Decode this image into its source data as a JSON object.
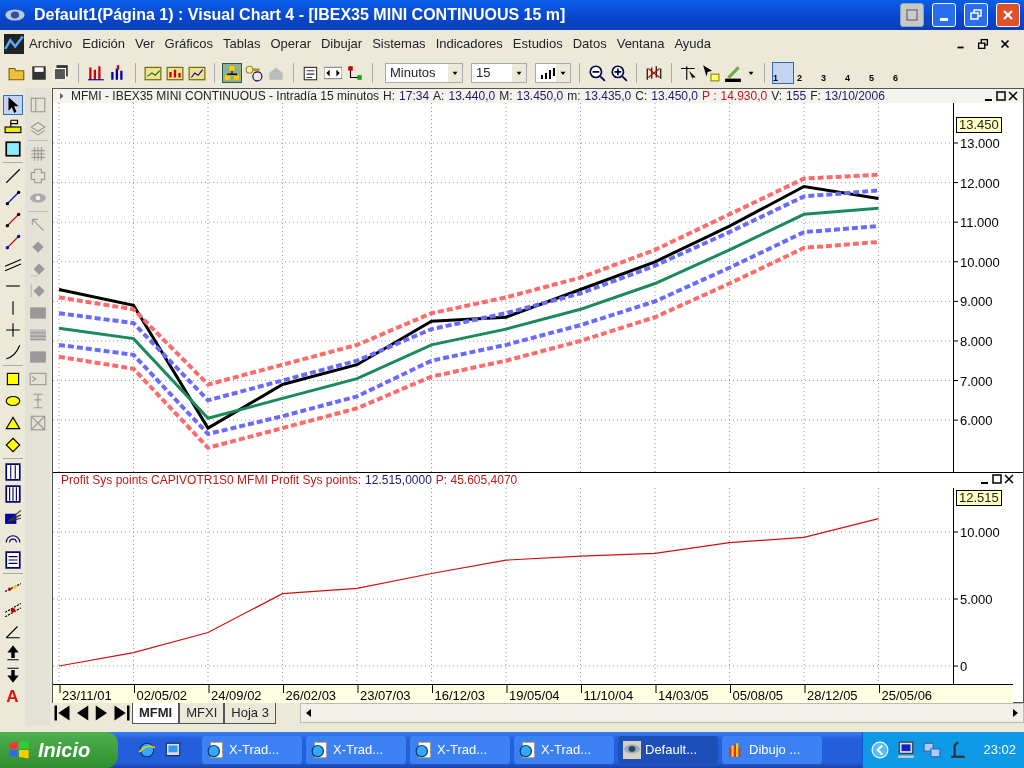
{
  "window": {
    "title": "Default1(Página 1) : Visual Chart 4 - [IBEX35 MINI CONTINUOUS 15 m]"
  },
  "menu": [
    "Archivo",
    "Edición",
    "Ver",
    "Gráficos",
    "Tablas",
    "Operar",
    "Dibujar",
    "Sistemas",
    "Indicadores",
    "Estudios",
    "Datos",
    "Ventana",
    "Ayuda"
  ],
  "toolbar": {
    "link_pressed": true,
    "timeframe": "Minutos",
    "interval": "15",
    "layouts": [
      {
        "label": "1",
        "selected": true
      },
      {
        "label": "2",
        "selected": false
      },
      {
        "label": "3",
        "selected": false
      },
      {
        "label": "4",
        "selected": false
      },
      {
        "label": "5",
        "selected": false
      },
      {
        "label": "6",
        "selected": false
      }
    ]
  },
  "left_toolbar": {
    "text_tool": "A"
  },
  "price_pane": {
    "title": "MFMI - IBEX35 MINI CONTINUOUS - Intradía 15 minutos",
    "fields": [
      {
        "label": "H:",
        "value": "17:34",
        "kind": "normal"
      },
      {
        "label": "A:",
        "value": "13.440,0",
        "kind": "normal"
      },
      {
        "label": "M:",
        "value": "13.450,0",
        "kind": "normal"
      },
      {
        "label": "m:",
        "value": "13.435,0",
        "kind": "normal"
      },
      {
        "label": "C:",
        "value": "13.450,0",
        "kind": "normal"
      },
      {
        "label": "P :",
        "value": "14.930,0",
        "kind": "alert"
      },
      {
        "label": "V:",
        "value": "155",
        "kind": "normal"
      },
      {
        "label": "F:",
        "value": "13/10/2006",
        "kind": "normal"
      }
    ],
    "current_value": "13.450",
    "chart_data": {
      "type": "line",
      "grid": true,
      "ylim": [
        4690,
        14010
      ],
      "yticks": [
        {
          "value": 6000,
          "label": "6.000"
        },
        {
          "value": 7000,
          "label": "7.000"
        },
        {
          "value": 8000,
          "label": "8.000"
        },
        {
          "value": 9000,
          "label": "9.000"
        },
        {
          "value": 10000,
          "label": "10.000"
        },
        {
          "value": 11000,
          "label": "11.000"
        },
        {
          "value": 12000,
          "label": "12.000"
        },
        {
          "value": 13000,
          "label": "13.000"
        }
      ],
      "series": [
        {
          "color": "#000000",
          "values": [
            9300,
            8900,
            5800,
            6900,
            7400,
            8500,
            8600,
            9300,
            10000,
            10900,
            11900,
            11600
          ]
        },
        {
          "color": "#ff6a6a",
          "line_style": "dashed",
          "values": [
            9100,
            8800,
            6900,
            7400,
            7900,
            8700,
            9100,
            9600,
            10300,
            11200,
            12100,
            12200
          ]
        },
        {
          "color": "#6a6aff",
          "line_style": "dashed",
          "values": [
            8700,
            8450,
            6500,
            7000,
            7500,
            8300,
            8700,
            9200,
            9900,
            10750,
            11650,
            11800
          ]
        },
        {
          "color": "#1a8a5a",
          "values": [
            8320,
            8060,
            6050,
            6550,
            7050,
            7900,
            8300,
            8800,
            9450,
            10300,
            11200,
            11350
          ]
        },
        {
          "color": "#6a6aff",
          "line_style": "dashed",
          "values": [
            7900,
            7650,
            5650,
            6100,
            6600,
            7500,
            7900,
            8400,
            9000,
            9850,
            10750,
            10900
          ]
        },
        {
          "color": "#ff6a6a",
          "line_style": "dashed",
          "values": [
            7600,
            7300,
            5300,
            5800,
            6300,
            7100,
            7500,
            8000,
            8600,
            9450,
            10350,
            10500
          ]
        }
      ]
    }
  },
  "profit_pane": {
    "title": "Profit Sys points  CAPIVOTR1S0  MFMI Profit Sys points:",
    "value": "12.515,0000",
    "extra": "P: 45.605,4070",
    "current_value": "12.515",
    "chart_data": {
      "type": "line",
      "grid": true,
      "ylim": [
        -1340,
        13280
      ],
      "categories": [
        "23/11/01",
        "02/05/02",
        "24/09/02",
        "26/02/03",
        "23/07/03",
        "16/12/03",
        "19/05/04",
        "11/10/04",
        "14/03/05",
        "05/08/05",
        "28/12/05",
        "25/05/06"
      ],
      "yticks": [
        {
          "value": 0,
          "label": "0"
        },
        {
          "value": 5000,
          "label": "5.000"
        },
        {
          "value": 10000,
          "label": "10.000"
        }
      ],
      "series": [
        {
          "color": "#d01010",
          "values": [
            0,
            1000,
            2500,
            5400,
            5800,
            6900,
            7900,
            8200,
            8400,
            9200,
            9600,
            11000
          ]
        }
      ]
    }
  },
  "sheet_tabs": [
    {
      "label": "MFMI",
      "selected": true
    },
    {
      "label": "MFXI",
      "selected": false
    },
    {
      "label": "Hoja 3",
      "selected": false
    }
  ],
  "taskbar": {
    "start": "Inicio",
    "tasks": [
      {
        "label": "X-Trad...",
        "kind": "browser",
        "selected": false
      },
      {
        "label": "X-Trad...",
        "kind": "browser",
        "selected": false
      },
      {
        "label": "X-Trad...",
        "kind": "browser",
        "selected": false
      },
      {
        "label": "X-Trad...",
        "kind": "browser",
        "selected": false
      },
      {
        "label": "Default...",
        "kind": "app",
        "selected": true
      },
      {
        "label": "Dibujo ...",
        "kind": "paint",
        "selected": false
      }
    ],
    "clock": "23:02"
  }
}
